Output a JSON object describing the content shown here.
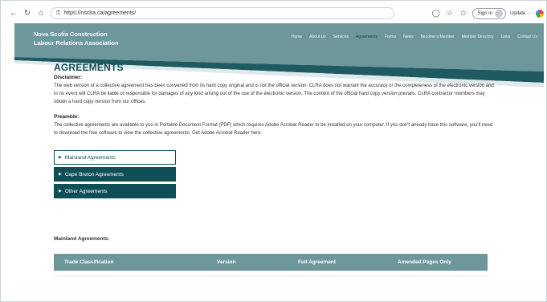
{
  "browser": {
    "url": "https://nsclra.ca/agreements/",
    "sign_in_label": "Sign in",
    "update_label": "Update ···"
  },
  "header": {
    "brand_line1": "Nova Scotia Construction",
    "brand_line2": "Labour Relations Association",
    "nav": [
      {
        "label": "Home"
      },
      {
        "label": "About Us"
      },
      {
        "label": "Services"
      },
      {
        "label": "Agreements",
        "active": true
      },
      {
        "label": "Forms"
      },
      {
        "label": "News"
      },
      {
        "label": "Become a Member"
      },
      {
        "label": "Member Directory"
      },
      {
        "label": "Links"
      },
      {
        "label": "Contact Us"
      }
    ],
    "colors": {
      "header": "#6e979c",
      "accent_band": "#1f5a61"
    }
  },
  "page": {
    "title": "AGREEMENTS",
    "disclaimer_label": "Disclaimer:",
    "disclaimer_text": "The web version of a collective agreement has been converted from its hard copy original and is not the official version. CLRA does not warrant the accuracy or the completeness of the electronic version and in no event will CLRA be liable or responsible for damages of any kind arising out of the use of the electronic version. The content of the official hard copy version prevails. CLRA contractor members may obtain a hard copy version from our offices.",
    "preamble_label": "Preamble:",
    "preamble_text": "The collective agreements are available to you in Portable Document Format (PDF) which requires Adobe Acrobat Reader to be installed on your computer. If you don't already have this software, you'll need to download the free software to view the collective agreements. Get Adobe Acrobat Reader here."
  },
  "accordion": [
    {
      "label": "Mainland Agreements",
      "style": "light"
    },
    {
      "label": "Cape Breton Agreements",
      "style": "dark"
    },
    {
      "label": "Other Agreements",
      "style": "dark"
    }
  ],
  "table": {
    "label": "Mainland Agreements:",
    "columns": [
      "Trade Classification",
      "Version",
      "Full Agreement",
      "Amended Pages Only"
    ]
  }
}
